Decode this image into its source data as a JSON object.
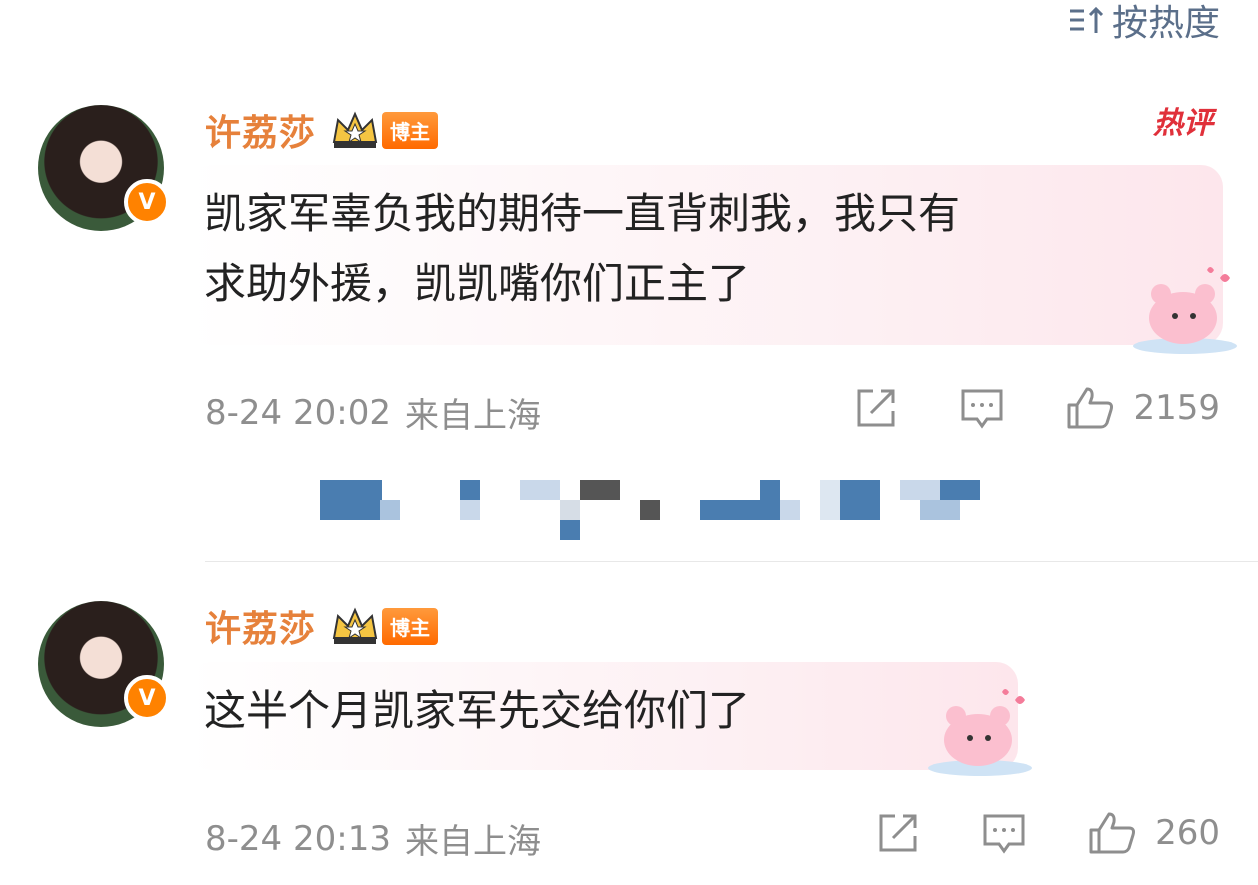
{
  "sort": {
    "label": "按热度",
    "icon": "sort-icon"
  },
  "comments": [
    {
      "username": "许荔莎",
      "badge": "博主",
      "hot_tag": "热评",
      "text_line1": "凯家军辜负我的期待一直背刺我，我只有",
      "text_line2": "求助外援，凯凯嘴你们正主了",
      "time": "8-24 20:02",
      "location": "来自上海",
      "likes": "2159"
    },
    {
      "username": "许荔莎",
      "badge": "博主",
      "text_line1": "这半个月凯家军先交给你们了",
      "time": "8-24 20:13",
      "location": "来自上海",
      "likes": "260"
    }
  ],
  "colors": {
    "username": "#e6813b",
    "meta": "#8e8e8e",
    "verify": "#ff8200",
    "hot": "#e0303a"
  }
}
